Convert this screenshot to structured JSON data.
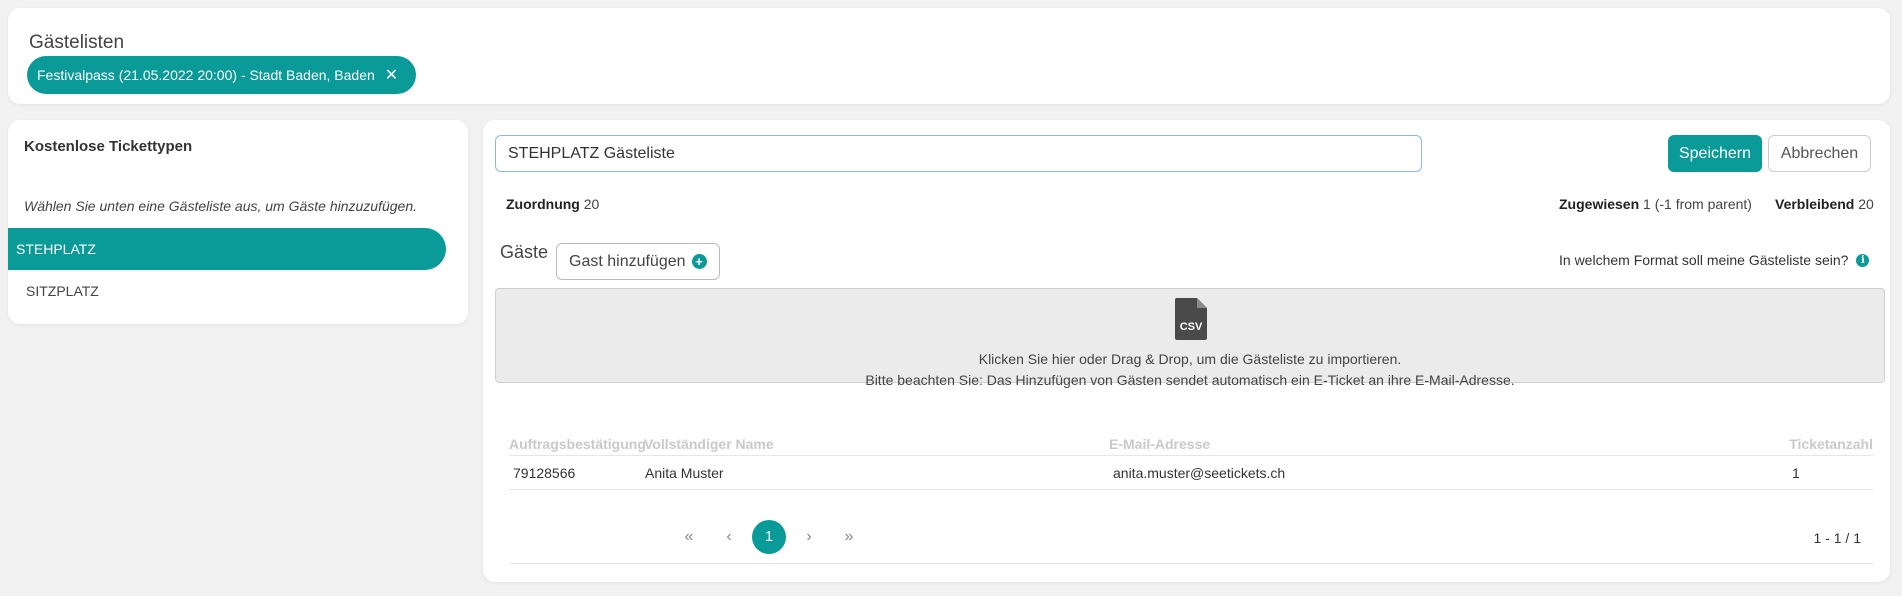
{
  "header": {
    "title": "Gästelisten",
    "event_chip": "Festivalpass (21.05.2022 20:00) - Stadt Baden, Baden",
    "chip_close": "✕"
  },
  "left_panel": {
    "title": "Kostenlose Tickettypen",
    "hint": "Wählen Sie unten eine Gästeliste aus, um Gäste hinzuzufügen.",
    "ticket_types": [
      {
        "label": "STEHPLATZ",
        "active": true
      },
      {
        "label": "SITZPLATZ",
        "active": false
      }
    ]
  },
  "editor": {
    "list_name_value": "STEHPLATZ Gästeliste",
    "save_label": "Speichern",
    "cancel_label": "Abbrechen"
  },
  "stats": {
    "allocation_label": "Zuordnung",
    "allocation_value": "20",
    "assigned_label": "Zugewiesen",
    "assigned_value": "1 (-1 from parent)",
    "remaining_label": "Verbleibend",
    "remaining_value": "20"
  },
  "guests": {
    "heading": "Gäste",
    "add_label": "Gast hinzufügen",
    "format_question": "In welchem Format soll meine Gästeliste sein?",
    "info_icon": "i"
  },
  "dropzone": {
    "icon_text": "CSV",
    "line1": "Klicken Sie hier oder Drag & Drop, um die Gästeliste zu importieren.",
    "line2": "Bitte beachten Sie: Das Hinzufügen von Gästen sendet automatisch ein E-Ticket an ihre E-Mail-Adresse."
  },
  "table": {
    "columns": [
      "Auftragsbestätigung",
      "Vollständiger Name",
      "E-Mail-Adresse",
      "Ticketanzahl"
    ],
    "rows": [
      [
        "79128566",
        "Anita Muster",
        "anita.muster@seetickets.ch",
        "1"
      ]
    ]
  },
  "pagination": {
    "first": "«",
    "prev": "‹",
    "current": "1",
    "next": "›",
    "last": "»",
    "range": "1 - 1 / 1"
  },
  "colors": {
    "accent": "#0a9a97",
    "input_border": "#8cb6e8"
  }
}
